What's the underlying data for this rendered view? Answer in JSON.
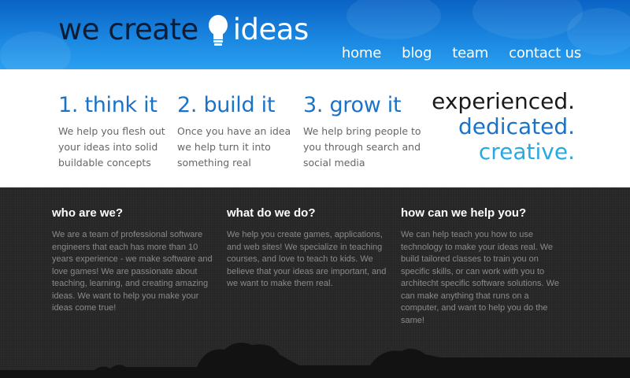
{
  "header": {
    "logo_prefix": "we create",
    "logo_suffix": "ideas",
    "nav": [
      "home",
      "blog",
      "team",
      "contact us"
    ]
  },
  "steps": [
    {
      "title": "1. think it",
      "text": "We help you flesh out your ideas into solid buildable concepts"
    },
    {
      "title": "2. build it",
      "text": "Once you have an idea we help turn it into something real"
    },
    {
      "title": "3. grow it",
      "text": "We help bring people to you through search and social media"
    }
  ],
  "tagline": [
    "experienced.",
    "dedicated.",
    "creative."
  ],
  "columns": [
    {
      "heading": "who are we?",
      "text": "We are a team of professional software engineers that each has more than 10 years experience - we make software and love games! We are passionate about teaching, learning, and creating amazing ideas. We want to help you make your ideas come true!"
    },
    {
      "heading": "what do we do?",
      "text": "We help you create games, applications, and web sites! We specialize in teaching courses, and love to teach to kids. We believe that your ideas are important, and we want to make them real."
    },
    {
      "heading": "how can we help you?",
      "text": "We can help teach you how to use technology to make your ideas real. We build tailored classes to train you on specific skills, or can work with you to architecht specific software solutions. We can make anything that runs on a computer, and want to help you do the same!"
    }
  ],
  "icons": {
    "logo": "lightbulb-icon"
  },
  "colors": {
    "header_blue": "#1a86e0",
    "accent": "#1a73c8",
    "light_accent": "#29a9e0",
    "dark_bg": "#262626"
  }
}
